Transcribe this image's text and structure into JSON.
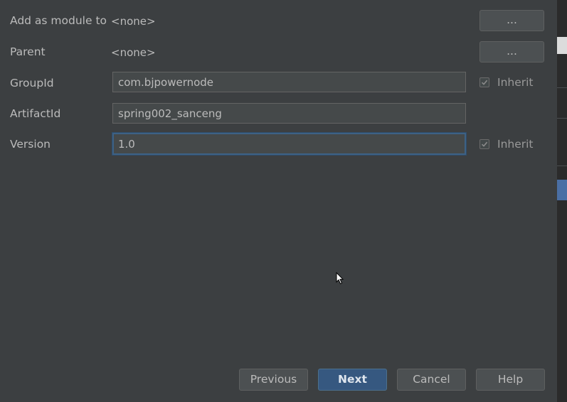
{
  "form": {
    "module": {
      "label": "Add as module to",
      "value": "<none>",
      "button_label": "..."
    },
    "parent": {
      "label": "Parent",
      "value": "<none>",
      "button_label": "..."
    },
    "group_id": {
      "label": "GroupId",
      "value": "com.bjpowernode",
      "inherit_label": "Inherit",
      "inherit_checked": true
    },
    "artifact_id": {
      "label": "ArtifactId",
      "value": "spring002_sanceng"
    },
    "version": {
      "label": "Version",
      "value": "1.0",
      "inherit_label": "Inherit",
      "inherit_checked": true
    }
  },
  "footer": {
    "previous_label": "Previous",
    "next_label": "Next",
    "cancel_label": "Cancel",
    "help_label": "Help"
  },
  "colors": {
    "background": "#3c3f41",
    "primary_button": "#365880",
    "focus_border": "#3d6185",
    "text": "#bbbbbb"
  },
  "icons": {
    "checkbox": "checkmark-icon",
    "pointer": "mouse-pointer-icon"
  }
}
